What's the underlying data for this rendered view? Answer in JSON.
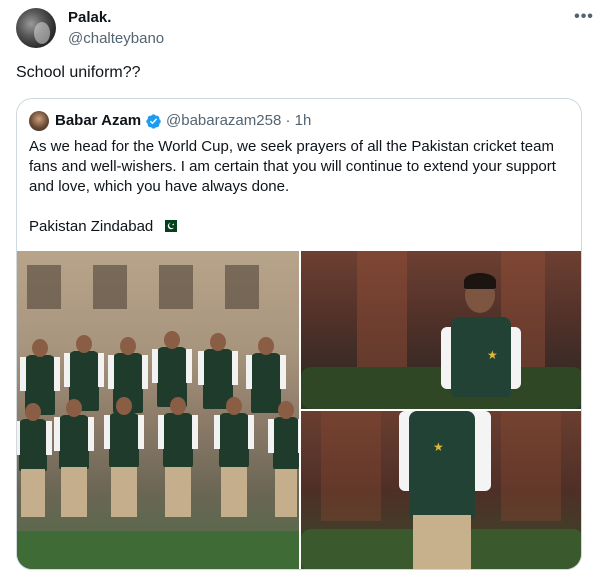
{
  "tweet": {
    "author_name": "Palak.",
    "author_handle": "@chalteybano",
    "text": "School uniform??",
    "more_icon": "more-horizontal-icon"
  },
  "quote": {
    "author_name": "Babar Azam",
    "author_handle_time": "@babarazam258 · 1h",
    "verified_icon": "verified-badge-icon",
    "paragraphs": [
      "As we head for the World Cup, we seek prayers of all the Pakistan cricket team fans and well-wishers. I am certain that you will continue to extend your support and love, which you have always done.",
      "Pakistan Zindabad"
    ],
    "flag_icon": "pakistan-flag-icon",
    "media": [
      {
        "name": "team-photo"
      },
      {
        "name": "portrait-seated-photo"
      },
      {
        "name": "portrait-standing-photo"
      }
    ]
  },
  "colors": {
    "text": "#0f1419",
    "secondary": "#536471",
    "border": "#cfd9de",
    "verified": "#1d9bf0",
    "jersey_green": "#1f3b2c"
  }
}
